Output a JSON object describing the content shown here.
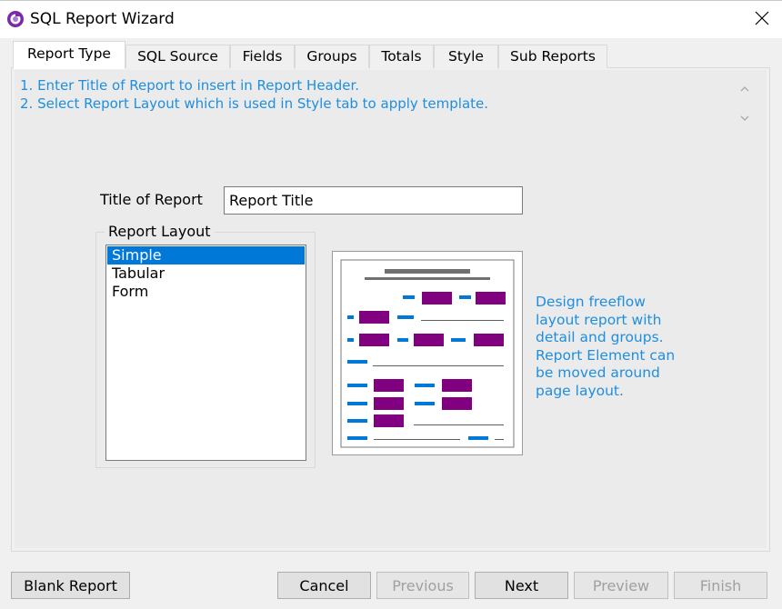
{
  "window": {
    "title": "SQL Report Wizard"
  },
  "tabs": [
    {
      "label": "Report Type",
      "active": true
    },
    {
      "label": "SQL Source",
      "active": false
    },
    {
      "label": "Fields",
      "active": false
    },
    {
      "label": "Groups",
      "active": false
    },
    {
      "label": "Totals",
      "active": false
    },
    {
      "label": "Style",
      "active": false
    },
    {
      "label": "Sub Reports",
      "active": false
    }
  ],
  "instructions": {
    "line1": "1. Enter Title of Report to insert in Report Header.",
    "line2": "2. Select Report Layout which is used in Style tab to apply template."
  },
  "form": {
    "title_label": "Title of Report",
    "title_value": "Report Title",
    "layout_group_label": "Report Layout",
    "layouts": [
      "Simple",
      "Tabular",
      "Form"
    ],
    "selected_layout": "Simple"
  },
  "description": {
    "line1": "Design freeflow",
    "line2": "layout report with",
    "line3": "detail and groups.",
    "line4": "Report Element can",
    "line5": "be moved around",
    "line6": "page layout."
  },
  "buttons": {
    "blank_report": "Blank Report",
    "cancel": "Cancel",
    "previous": "Previous",
    "next": "Next",
    "preview": "Preview",
    "finish": "Finish"
  },
  "colors": {
    "accent_text": "#1e8fe0",
    "selection": "#0078d7",
    "preview_field": "#800080",
    "preview_label": "#0078d7",
    "app_icon": "#7a2aa8"
  }
}
